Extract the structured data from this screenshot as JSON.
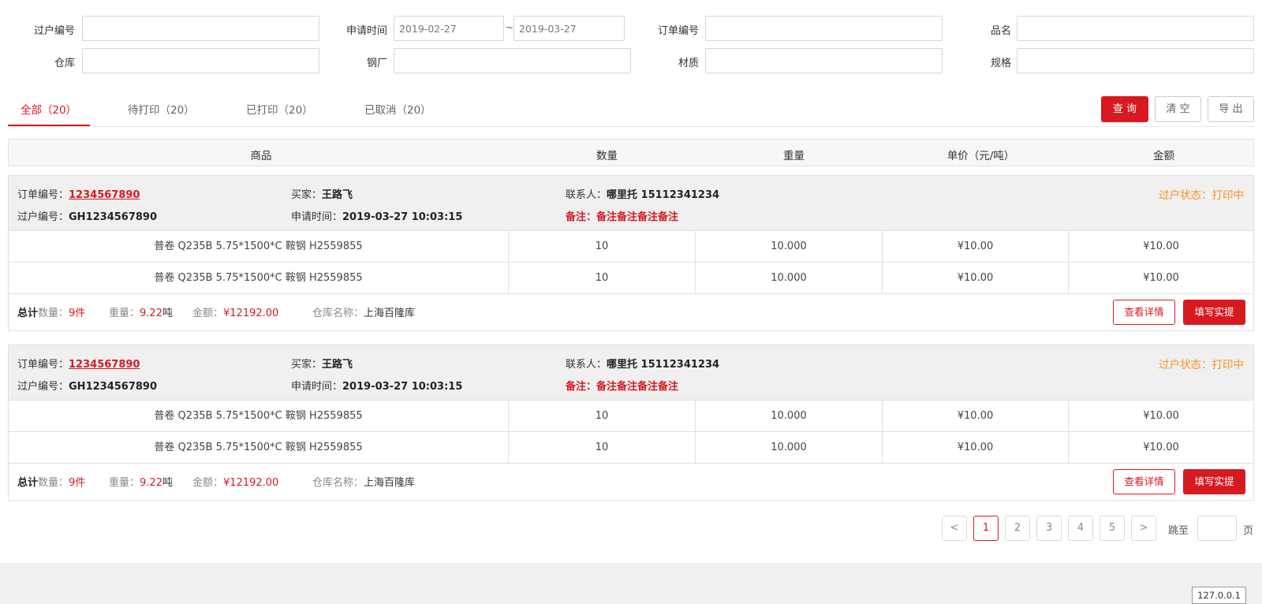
{
  "filters": {
    "row1": {
      "transfer_no_label": "过户编号",
      "apply_time_label": "申请时间",
      "date_start": "2019-02-27",
      "date_sep": "~",
      "date_end": "2019-03-27",
      "order_no_label": "订单编号",
      "product_label": "品名"
    },
    "row2": {
      "warehouse_label": "仓库",
      "mill_label": "钢厂",
      "material_label": "材质",
      "spec_label": "规格"
    }
  },
  "tabs": [
    {
      "label": "全部（20）"
    },
    {
      "label": "待打印（20）"
    },
    {
      "label": "已打印（20）"
    },
    {
      "label": "已取消（20）"
    }
  ],
  "actions": {
    "query": "查 询",
    "clear": "清 空",
    "export": "导 出"
  },
  "table_header": {
    "product": "商品",
    "qty": "数量",
    "weight": "重量",
    "unit_price": "单价（元/吨）",
    "amount": "金额"
  },
  "orders": [
    {
      "order_no_label": "订单编号：",
      "order_no": "1234567890",
      "buyer_label": "买家：",
      "buyer": "王路飞",
      "contact_label": "联系人：",
      "contact": "哪里托  15112341234",
      "status": "过户状态：打印中",
      "transfer_no_label": "过户编号：",
      "transfer_no": "GH1234567890",
      "apply_time_label": "申请时间：",
      "apply_time": "2019-03-27 10:03:15",
      "remark_label": "备注：",
      "remark": "备注备注备注备注",
      "lines": [
        {
          "product": "普卷 Q235B 5.75*1500*C 鞍钢 H2559855",
          "qty": "10",
          "weight": "10.000",
          "unit_price": "¥10.00",
          "amount": "¥10.00"
        },
        {
          "product": "普卷 Q235B 5.75*1500*C 鞍钢 H2559855",
          "qty": "10",
          "weight": "10.000",
          "unit_price": "¥10.00",
          "amount": "¥10.00"
        }
      ],
      "footer": {
        "total_label": "总计",
        "qty_label": "数量：",
        "qty": "9件",
        "weight_label": "重量：",
        "weight": "9.22",
        "weight_unit": "吨",
        "amount_label": "金额：",
        "amount": "¥12192.00",
        "warehouse_label": "仓库名称：",
        "warehouse": "上海百隆库",
        "detail_btn": "查看详情",
        "fill_btn": "填写实提"
      }
    },
    {
      "order_no_label": "订单编号：",
      "order_no": "1234567890",
      "buyer_label": "买家：",
      "buyer": "王路飞",
      "contact_label": "联系人：",
      "contact": "哪里托  15112341234",
      "status": "过户状态：打印中",
      "transfer_no_label": "过户编号：",
      "transfer_no": "GH1234567890",
      "apply_time_label": "申请时间：",
      "apply_time": "2019-03-27 10:03:15",
      "remark_label": "备注：",
      "remark": "备注备注备注备注",
      "lines": [
        {
          "product": "普卷 Q235B 5.75*1500*C 鞍钢 H2559855",
          "qty": "10",
          "weight": "10.000",
          "unit_price": "¥10.00",
          "amount": "¥10.00"
        },
        {
          "product": "普卷 Q235B 5.75*1500*C 鞍钢 H2559855",
          "qty": "10",
          "weight": "10.000",
          "unit_price": "¥10.00",
          "amount": "¥10.00"
        }
      ],
      "footer": {
        "total_label": "总计",
        "qty_label": "数量：",
        "qty": "9件",
        "weight_label": "重量：",
        "weight": "9.22",
        "weight_unit": "吨",
        "amount_label": "金额：",
        "amount": "¥12192.00",
        "warehouse_label": "仓库名称：",
        "warehouse": "上海百隆库",
        "detail_btn": "查看详情",
        "fill_btn": "填写实提"
      }
    }
  ],
  "pagination": {
    "prev": "<",
    "pages": [
      "1",
      "2",
      "3",
      "4",
      "5"
    ],
    "next": ">",
    "jump_label": "跳至",
    "page_unit": "页"
  },
  "footer_badge": "127.0.0.1",
  "colors": {
    "accent": "#d71920",
    "status": "#f7931e"
  }
}
